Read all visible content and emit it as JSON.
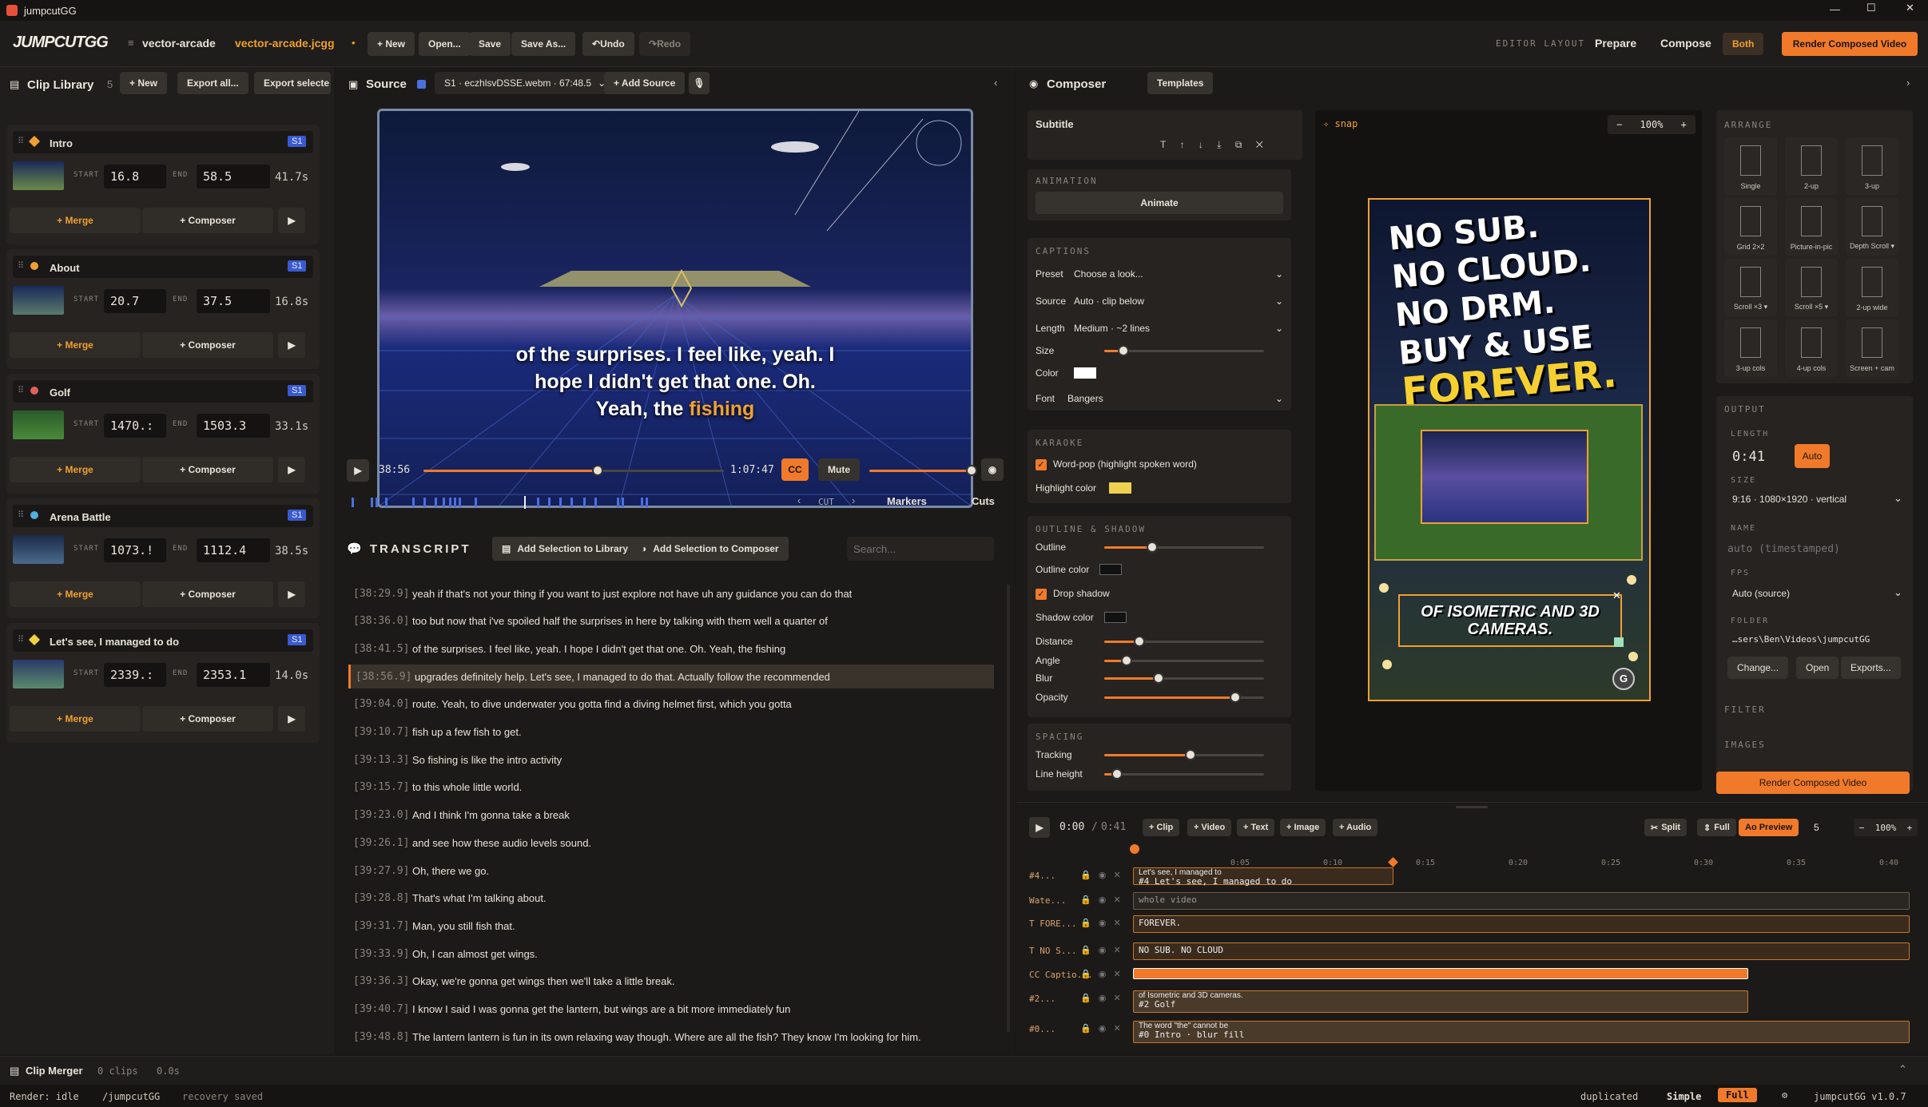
{
  "window": {
    "title": "jumpcutGG"
  },
  "app": {
    "logo": "JUMPCUTGG",
    "project_short": "vector-arcade",
    "project_file": "vector-arcade.jcgg",
    "dirty": "•",
    "buttons": {
      "new": "+ New",
      "open": "Open...",
      "save": "Save",
      "save_as": "Save As...",
      "undo": "Undo",
      "redo": "Redo"
    },
    "layout_label": "EDITOR LAYOUT",
    "layout_prepare": "Prepare",
    "layout_compose": "Compose",
    "layout_both": "Both",
    "render": "Render Composed Video"
  },
  "library": {
    "title": "Clip Library",
    "count": "5",
    "new": "+ New",
    "export_all": "Export all...",
    "export_selected": "Export selecte",
    "clips": [
      {
        "name": "Intro",
        "badge": "S1",
        "start": "16.8",
        "end": "58.5",
        "dur": "41.7s",
        "dot": "#f0a030"
      },
      {
        "name": "About",
        "badge": "S1",
        "start": "20.7",
        "end": "37.5",
        "dur": "16.8s",
        "dot": "#f0a030"
      },
      {
        "name": "Golf",
        "badge": "S1",
        "start": "1470.:",
        "end": "1503.3",
        "dur": "33.1s",
        "dot": "#e06060"
      },
      {
        "name": "Arena Battle",
        "badge": "S1",
        "start": "1073.!",
        "end": "1112.4",
        "dur": "38.5s",
        "dot": "#50b0e0"
      },
      {
        "name": "Let's see, I managed to do",
        "badge": "S1",
        "start": "2339.:",
        "end": "2353.1",
        "dur": "14.0s",
        "dot": "#f0d040"
      }
    ],
    "start_label": "START",
    "end_label": "END",
    "merge": "+ Merge",
    "composer": "+ Composer"
  },
  "source": {
    "title": "Source",
    "file": "S1 · eczhlsvDSSE.webm · 67:48.5",
    "add": "+ Add Source",
    "subtitle_line1": "of the surprises. I feel like, yeah. I",
    "subtitle_line2": "hope I didn't get that one. Oh.",
    "subtitle_line3a": "Yeah, the ",
    "subtitle_line3b": "fishing",
    "time_cur": "38:56",
    "time_total": "1:07:47",
    "cc": "CC",
    "mute": "Mute",
    "cut": "CUT",
    "markers": "Markers",
    "cuts": "Cuts",
    "progress": 0.58,
    "volume": 1.0
  },
  "transcript": {
    "title": "TRANSCRIPT",
    "add_library": "Add Selection to Library",
    "add_composer": "Add Selection to Composer",
    "search_ph": "Search...",
    "rows": [
      {
        "t": "[38:29.9]",
        "text": "yeah if that's not your thing if you want to just explore not have uh any guidance you can do that"
      },
      {
        "t": "[38:36.0]",
        "text": "too but now that i've spoiled half the surprises in here by talking with them well a quarter of"
      },
      {
        "t": "[38:41.5]",
        "text": "of the surprises. I feel like, yeah. I hope I didn't get that one. Oh. Yeah, the fishing"
      },
      {
        "t": "[38:56.9]",
        "text": "upgrades definitely help. Let's see, I managed to do that. Actually follow the recommended"
      },
      {
        "t": "[39:04.0]",
        "text": "route. Yeah, to dive underwater you gotta find a diving helmet first, which you gotta"
      },
      {
        "t": "[39:10.7]",
        "text": "fish up a few fish to get."
      },
      {
        "t": "[39:13.3]",
        "text": "So fishing is like the intro activity"
      },
      {
        "t": "[39:15.7]",
        "text": "to this whole little world."
      },
      {
        "t": "[39:23.0]",
        "text": "And I think I'm gonna take a break"
      },
      {
        "t": "[39:26.1]",
        "text": "and see how these audio levels sound."
      },
      {
        "t": "[39:27.9]",
        "text": "Oh, there we go."
      },
      {
        "t": "[39:28.8]",
        "text": "That's what I'm talking about."
      },
      {
        "t": "[39:31.7]",
        "text": "Man, you still fish that."
      },
      {
        "t": "[39:33.9]",
        "text": "Oh, I can almost get wings."
      },
      {
        "t": "[39:36.3]",
        "text": "Okay, we're gonna get wings then we'll take a little break."
      },
      {
        "t": "[39:40.7]",
        "text": "I know I said I was gonna get the lantern, but wings are a bit more immediately fun"
      },
      {
        "t": "[39:48.8]",
        "text": "The lantern lantern is fun in its own relaxing way though. Where are all the fish? They know I'm looking for him."
      }
    ]
  },
  "composer": {
    "title": "Composer",
    "templates": "Templates",
    "snap": "snap",
    "zoom": "100%",
    "subtitle_label": "Subtitle",
    "animation": "ANIMATION",
    "animate": "Animate",
    "captions": "CAPTIONS",
    "preset_l": "Preset",
    "preset_v": "Choose a look...",
    "source_l": "Source",
    "source_v": "Auto · clip below",
    "length_l": "Length",
    "length_v": "Medium · ~2 lines",
    "size_l": "Size",
    "color_l": "Color",
    "font_l": "Font",
    "font_v": "Bangers",
    "karaoke": "KARAOKE",
    "wordpop": "Word-pop (highlight spoken word)",
    "highlight": "Highlight color",
    "outline_h": "OUTLINE & SHADOW",
    "outline": "Outline",
    "outline_color": "Outline color",
    "drop": "Drop shadow",
    "shadow_color": "Shadow color",
    "distance": "Distance",
    "angle": "Angle",
    "blur": "Blur",
    "opacity": "Opacity",
    "spacing": "SPACING",
    "tracking": "Tracking",
    "line_height": "Line height",
    "sliders": {
      "size": 0.12,
      "outline": 0.3,
      "distance": 0.22,
      "angle": 0.14,
      "blur": 0.34,
      "opacity": 0.82,
      "tracking": 0.54,
      "line_height": 0.08
    },
    "preview": {
      "l1": "NO SUB.",
      "l2": "NO CLOUD.",
      "l3": "NO DRM.",
      "l4": "BUY & USE",
      "l5": "FOREVER.",
      "caption": "OF ISOMETRIC AND 3D CAMERAS."
    },
    "arrange": "ARRANGE",
    "layouts": [
      "Single",
      "2-up",
      "3-up",
      "Grid 2×2",
      "Picture-in-pic",
      "Depth Scroll ▾",
      "Scroll ×3 ▾",
      "Scroll ×5 ▾",
      "2-up wide",
      "3-up cols",
      "4-up cols",
      "Screen + cam"
    ],
    "output": "OUTPUT",
    "length_h": "LENGTH",
    "length_val": "0:41",
    "auto": "Auto",
    "size_h": "SIZE",
    "size_val": "9:16 · 1080×1920 · vertical",
    "name_h": "NAME",
    "name_ph": "auto (timestamped)",
    "fps_h": "FPS",
    "fps_val": "Auto (source)",
    "folder_h": "FOLDER",
    "folder_val": "…sers\\Ben\\Videos\\jumpcutGG",
    "change": "Change...",
    "open": "Open",
    "exports": "Exports...",
    "filter": "FILTER",
    "images": "IMAGES",
    "render": "Render Composed Video"
  },
  "timeline": {
    "cur": "0:00",
    "slash": "/",
    "total": "0:41",
    "add_clip": "+ Clip",
    "add_video": "+ Video",
    "add_text": "+ Text",
    "add_image": "+ Image",
    "add_audio": "+ Audio",
    "split": "Split",
    "full": "Full",
    "preview": "Ao Preview",
    "num": "5",
    "zoom": "100%",
    "ticks": [
      "0:05",
      "0:10",
      "0:15",
      "0:20",
      "0:25",
      "0:30",
      "0:35",
      "0:40"
    ],
    "tracks": [
      {
        "label": "#4...",
        "text": "#4 Let's see, I managed to do",
        "top_text": "Let's see, I managed to"
      },
      {
        "label": "Wate...",
        "text": "whole video"
      },
      {
        "label": "T FORE...",
        "text": "FOREVER."
      },
      {
        "label": "T NO S...",
        "text": "NO SUB. NO CLOUD"
      },
      {
        "label": "CC Captio...",
        "text": ""
      },
      {
        "label": "#2...",
        "text": "#2 Golf",
        "top_text": "of Isometric and 3D cameras."
      },
      {
        "label": "#0...",
        "text": "#0 Intro · blur fill",
        "top_text": "The word \"the\" cannot be"
      }
    ]
  },
  "merger": {
    "title": "Clip Merger",
    "clips": "0 clips",
    "dur": "0.0s"
  },
  "status": {
    "render": "Render: idle",
    "path": "/jumpcutGG",
    "recovery": "recovery saved",
    "dup": "duplicated",
    "simple": "Simple",
    "full": "Full",
    "version": "jumpcutGG v1.0.7"
  }
}
